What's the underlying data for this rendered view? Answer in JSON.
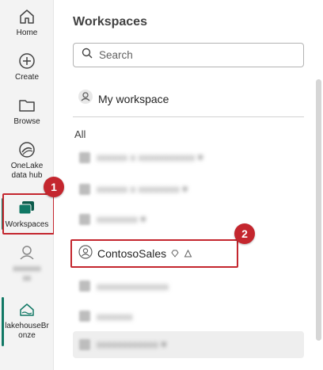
{
  "nav": {
    "items": [
      {
        "label": "Home",
        "icon": "home-icon"
      },
      {
        "label": "Create",
        "icon": "plus-circle-icon"
      },
      {
        "label": "Browse",
        "icon": "folder-icon"
      },
      {
        "label": "OneLake data hub",
        "label_line1": "OneLake",
        "label_line2": "data hub",
        "icon": "onelake-icon"
      },
      {
        "label": "Workspaces",
        "icon": "workspaces-icon"
      },
      {
        "label": "lakehouseBronze",
        "label_line1": "lakehouseBr",
        "label_line2": "onze",
        "icon": "lakehouse-icon"
      }
    ],
    "accent": "#117865"
  },
  "panel": {
    "title": "Workspaces",
    "search_placeholder": "Search",
    "my_workspace": "My workspace",
    "section_label": "All",
    "workspaces": [
      {
        "label": "ContosoSales",
        "icon": "workspace-icon",
        "badges": [
          "premium-diamond-icon",
          "recycle-icon"
        ]
      }
    ]
  },
  "callouts": {
    "step1": "1",
    "step2": "2",
    "color": "#c4262e"
  }
}
